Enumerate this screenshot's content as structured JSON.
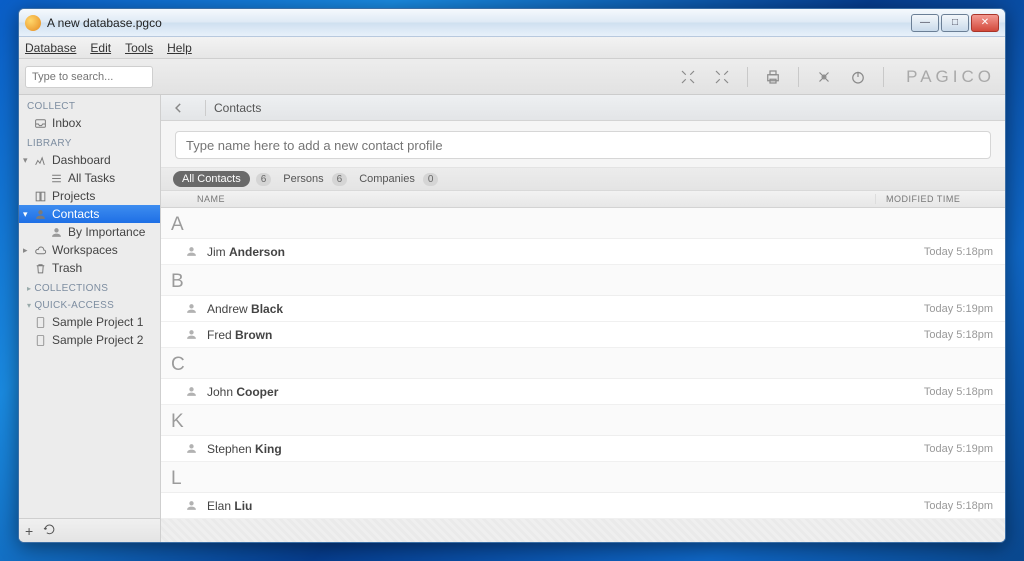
{
  "window": {
    "title": "A new database.pgco"
  },
  "menubar": [
    "Database",
    "Edit",
    "Tools",
    "Help"
  ],
  "toolbar": {
    "search_placeholder": "Type to search...",
    "brand": "PAGICO"
  },
  "sidebar": {
    "sections": [
      {
        "heading": "COLLECT",
        "caret": false,
        "items": [
          {
            "label": "Inbox",
            "icon": "inbox-icon"
          }
        ]
      },
      {
        "heading": "LIBRARY",
        "caret": false,
        "items": [
          {
            "label": "Dashboard",
            "icon": "dashboard-icon",
            "expandable": true,
            "open": true,
            "children": [
              {
                "label": "All Tasks",
                "icon": "tasks-icon"
              }
            ]
          },
          {
            "label": "Projects",
            "icon": "projects-icon"
          },
          {
            "label": "Contacts",
            "icon": "person-icon",
            "active": true,
            "expandable": true,
            "open": true,
            "children": [
              {
                "label": "By Importance",
                "icon": "person-sm-icon"
              }
            ]
          },
          {
            "label": "Workspaces",
            "icon": "cloud-icon",
            "expandable": true,
            "open": false
          },
          {
            "label": "Trash",
            "icon": "trash-icon"
          }
        ]
      },
      {
        "heading": "COLLECTIONS",
        "caret": true,
        "open": false,
        "items": []
      },
      {
        "heading": "QUICK-ACCESS",
        "caret": true,
        "open": true,
        "items": [
          {
            "label": "Sample Project 1",
            "icon": "doc-icon"
          },
          {
            "label": "Sample Project 2",
            "icon": "doc-icon"
          }
        ]
      }
    ]
  },
  "breadcrumb": {
    "current": "Contacts"
  },
  "add_contact_placeholder": "Type name here to add a new contact profile",
  "filters": {
    "all_label": "All Contacts",
    "all_count": "6",
    "persons_label": "Persons",
    "persons_count": "6",
    "companies_label": "Companies",
    "companies_count": "0"
  },
  "columns": {
    "name": "NAME",
    "modified": "MODIFIED TIME"
  },
  "groups": [
    {
      "letter": "A",
      "rows": [
        {
          "first": "Jim",
          "last": "Anderson",
          "time": "Today 5:18pm"
        }
      ]
    },
    {
      "letter": "B",
      "rows": [
        {
          "first": "Andrew",
          "last": "Black",
          "time": "Today 5:19pm"
        },
        {
          "first": "Fred",
          "last": "Brown",
          "time": "Today 5:18pm"
        }
      ]
    },
    {
      "letter": "C",
      "rows": [
        {
          "first": "John",
          "last": "Cooper",
          "time": "Today 5:18pm"
        }
      ]
    },
    {
      "letter": "K",
      "rows": [
        {
          "first": "Stephen",
          "last": "King",
          "time": "Today 5:19pm"
        }
      ]
    },
    {
      "letter": "L",
      "rows": [
        {
          "first": "Elan",
          "last": "Liu",
          "time": "Today 5:18pm"
        }
      ]
    }
  ]
}
